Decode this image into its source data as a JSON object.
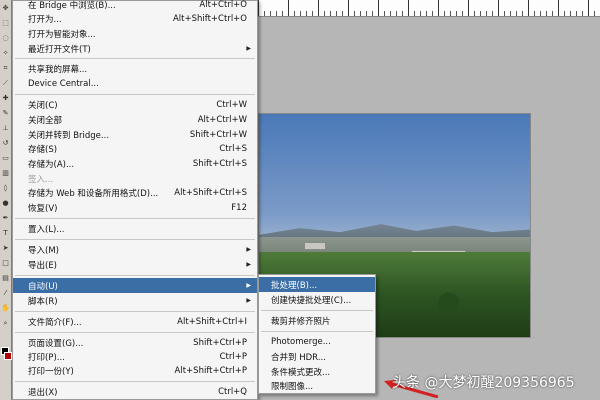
{
  "menu": {
    "items": [
      {
        "label": "在 Bridge 中浏览(B)...",
        "shortcut": "Alt+Ctrl+O"
      },
      {
        "label": "打开为...",
        "shortcut": "Alt+Shift+Ctrl+O"
      },
      {
        "label": "打开为智能对象...",
        "shortcut": ""
      },
      {
        "label": "最近打开文件(T)",
        "shortcut": ""
      },
      {
        "label": "共享我的屏幕...",
        "shortcut": ""
      },
      {
        "label": "Device Central...",
        "shortcut": ""
      },
      {
        "label": "关闭(C)",
        "shortcut": "Ctrl+W"
      },
      {
        "label": "关闭全部",
        "shortcut": "Alt+Ctrl+W"
      },
      {
        "label": "关闭并转到 Bridge...",
        "shortcut": "Shift+Ctrl+W"
      },
      {
        "label": "存储(S)",
        "shortcut": "Ctrl+S"
      },
      {
        "label": "存储为(A)...",
        "shortcut": "Shift+Ctrl+S"
      },
      {
        "label": "签入...",
        "shortcut": ""
      },
      {
        "label": "存储为 Web 和设备所用格式(D)...",
        "shortcut": "Alt+Shift+Ctrl+S"
      },
      {
        "label": "恢复(V)",
        "shortcut": "F12"
      },
      {
        "label": "置入(L)...",
        "shortcut": ""
      },
      {
        "label": "导入(M)",
        "shortcut": ""
      },
      {
        "label": "导出(E)",
        "shortcut": ""
      },
      {
        "label": "自动(U)",
        "shortcut": ""
      },
      {
        "label": "脚本(R)",
        "shortcut": ""
      },
      {
        "label": "文件简介(F)...",
        "shortcut": "Alt+Shift+Ctrl+I"
      },
      {
        "label": "页面设置(G)...",
        "shortcut": "Shift+Ctrl+P"
      },
      {
        "label": "打印(P)...",
        "shortcut": "Ctrl+P"
      },
      {
        "label": "打印一份(Y)",
        "shortcut": "Alt+Shift+Ctrl+P"
      },
      {
        "label": "退出(X)",
        "shortcut": "Ctrl+Q"
      }
    ]
  },
  "submenu": {
    "items": [
      {
        "label": "批处理(B)..."
      },
      {
        "label": "创建快捷批处理(C)..."
      },
      {
        "label": "裁剪并修齐照片"
      },
      {
        "label": "Photomerge..."
      },
      {
        "label": "合并到 HDR..."
      },
      {
        "label": "条件模式更改..."
      },
      {
        "label": "限制图像..."
      }
    ]
  },
  "watermark": "头条 @大梦初醒209356965",
  "colors": {
    "selection": "#3a6ea5",
    "annotation_arrow": "#d42020"
  }
}
